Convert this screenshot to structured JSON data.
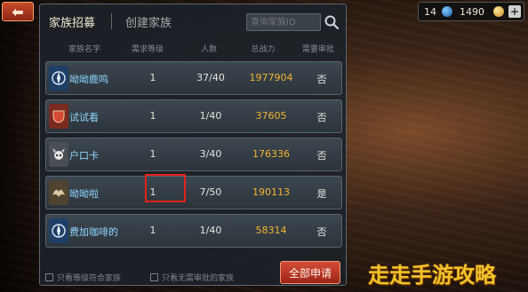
{
  "nav": {
    "back_icon": "back-arrow-icon"
  },
  "tabs": {
    "recruit": "家族招募",
    "create": "创建家族"
  },
  "search": {
    "placeholder": "查询家族ID",
    "icon": "search-icon"
  },
  "table": {
    "headers": [
      "家族名字",
      "需求等级",
      "人数",
      "总战力",
      "需要审批"
    ],
    "rows": [
      {
        "name": "呦呦鹿鸣",
        "level": "1",
        "members": "37/40",
        "power": "1977904",
        "approve": "否",
        "emblem": "compass-emblem-icon",
        "emblem_color": "#2c5c9a"
      },
      {
        "name": "试试看",
        "level": "1",
        "members": "1/40",
        "power": "37605",
        "approve": "否",
        "emblem": "red-shield-emblem-icon",
        "emblem_color": "#b23a2a"
      },
      {
        "name": "户口卡",
        "level": "1",
        "members": "3/40",
        "power": "176336",
        "approve": "否",
        "emblem": "horned-skull-emblem-icon",
        "emblem_color": "#8a8f96"
      },
      {
        "name": "呦呦啦",
        "level": "1",
        "members": "7/50",
        "power": "190113",
        "approve": "是",
        "emblem": "wing-emblem-icon",
        "emblem_color": "#6a5a3a"
      },
      {
        "name": "费加咖啡的",
        "level": "1",
        "members": "1/40",
        "power": "58314",
        "approve": "否",
        "emblem": "compass-emblem-icon",
        "emblem_color": "#2c5c9a"
      }
    ]
  },
  "filters": {
    "level_match": "只看等级符合家族",
    "no_approval": "只看无需审批的家族"
  },
  "apply_all": "全部申请",
  "currency": {
    "gems": "14",
    "coins": "1490",
    "plus_icon": "plus-icon"
  },
  "watermark": "走走手游攻略",
  "colors": {
    "name": "#8fd4ff",
    "power": "#f2b431",
    "highlight": "#e3221d",
    "button": "#c0392b",
    "watermark": "#f1c32b"
  }
}
